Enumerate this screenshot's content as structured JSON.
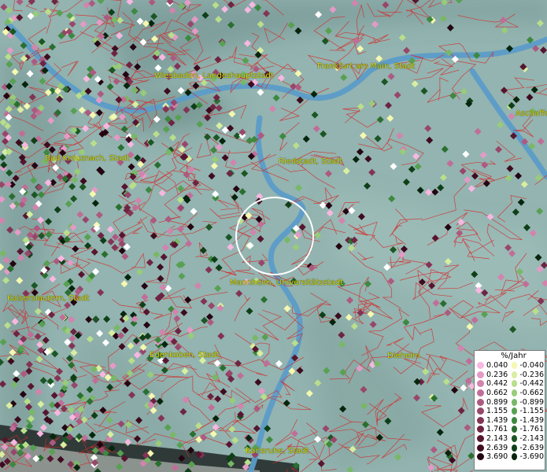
{
  "cities": [
    {
      "name": "Wiesbaden, Landeshauptstadt"
    },
    {
      "name": "Frankfurt am Main, Stadt"
    },
    {
      "name": "Aschaffe"
    },
    {
      "name": "Bad Kreuznach, Stadt"
    },
    {
      "name": "Riedstadt, Stadt"
    },
    {
      "name": "Mannheim, Universitätsstadt"
    },
    {
      "name": "Kaiserslautern, Stadt"
    },
    {
      "name": "Edenkoben, Stadt"
    },
    {
      "name": "Dieheim"
    },
    {
      "name": "Karlsruhe, Stadt"
    }
  ],
  "legend": {
    "title": "%/Jahr",
    "positive": [
      {
        "label": "0.040",
        "color": "#f7b7e0"
      },
      {
        "label": "0.236",
        "color": "#e49ac6"
      },
      {
        "label": "0.442",
        "color": "#d283ae"
      },
      {
        "label": "0.662",
        "color": "#c06e98"
      },
      {
        "label": "0.899",
        "color": "#ad5a80"
      },
      {
        "label": "1.155",
        "color": "#98476b"
      },
      {
        "label": "1.439",
        "color": "#833454"
      },
      {
        "label": "1.761",
        "color": "#6e2442"
      },
      {
        "label": "2.143",
        "color": "#571630"
      },
      {
        "label": "2.639",
        "color": "#3e0b1f"
      },
      {
        "label": "3.690",
        "color": "#240511"
      }
    ],
    "negative": [
      {
        "label": "-0.040",
        "color": "#f4f8b0"
      },
      {
        "label": "-0.236",
        "color": "#d8eea0"
      },
      {
        "label": "-0.442",
        "color": "#b9de8c"
      },
      {
        "label": "-0.662",
        "color": "#98cc79"
      },
      {
        "label": "-0.899",
        "color": "#78b866"
      },
      {
        "label": "-1.155",
        "color": "#58a052"
      },
      {
        "label": "-1.439",
        "color": "#3e8840"
      },
      {
        "label": "-1.761",
        "color": "#2a6f30"
      },
      {
        "label": "-2.143",
        "color": "#1b5624"
      },
      {
        "label": "-2.639",
        "color": "#0f3f18"
      },
      {
        "label": "-3.690",
        "color": "#06250d"
      }
    ]
  },
  "colors": {
    "land": "#8fb0ad",
    "river": "#5b9cc9",
    "boundary": "#d42a2a",
    "label": "#d8d800"
  }
}
